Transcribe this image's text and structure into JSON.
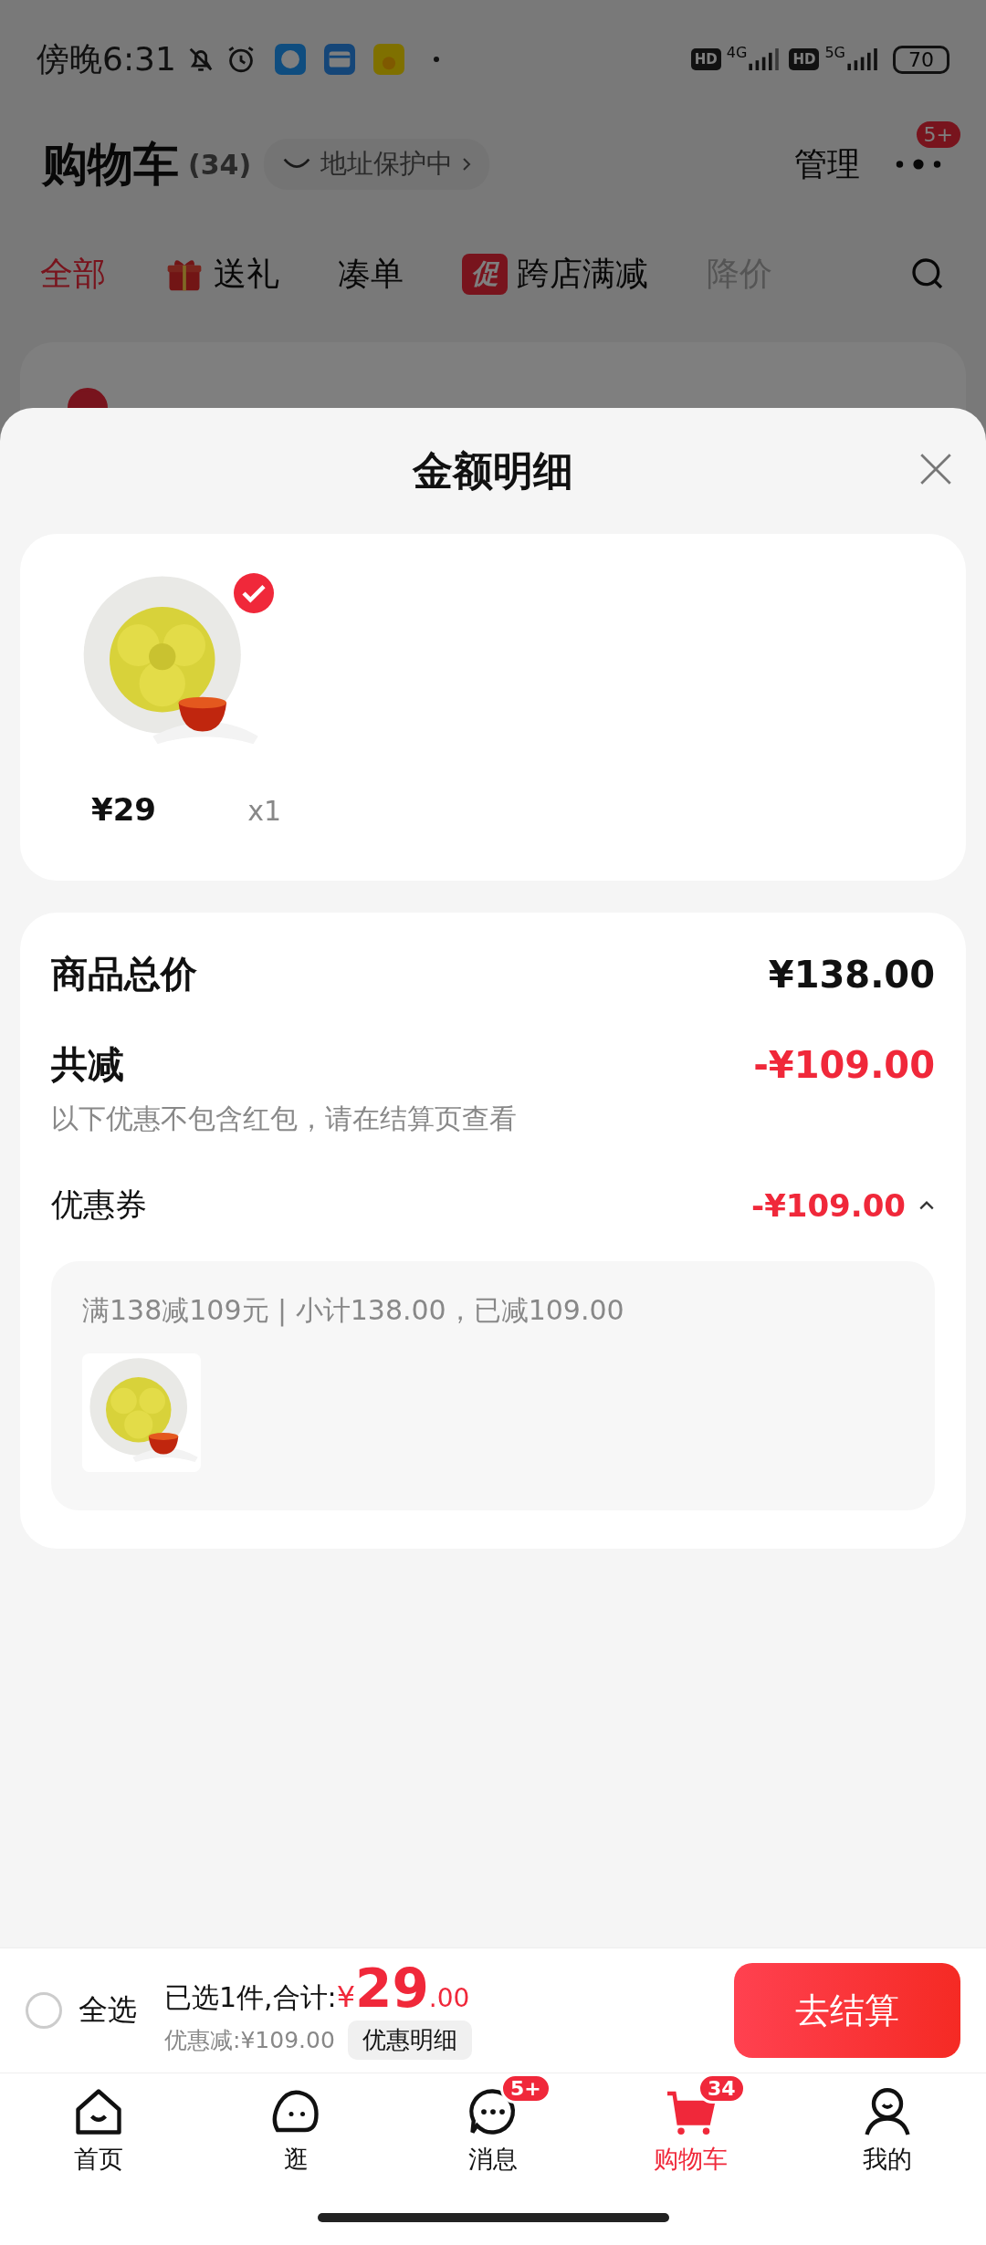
{
  "status_bar": {
    "time": "傍晚6:31",
    "sim1": {
      "hd": "HD",
      "net": "4G"
    },
    "sim2": {
      "hd": "HD",
      "net": "5G"
    },
    "battery": "70"
  },
  "header": {
    "title": "购物车",
    "count": "(34)",
    "address_badge": "地址保护中",
    "manage": "管理",
    "more_badge": "5+"
  },
  "tabs": [
    {
      "label": "全部",
      "selected": true,
      "kind": "text",
      "faded": false
    },
    {
      "label": "送礼",
      "selected": false,
      "kind": "gift",
      "faded": false
    },
    {
      "label": "凑单",
      "selected": false,
      "kind": "text",
      "faded": false
    },
    {
      "label": "跨店满减",
      "selected": false,
      "kind": "promo",
      "promo_mark": "促",
      "faded": false
    },
    {
      "label": "降价",
      "selected": false,
      "kind": "text",
      "faded": true
    }
  ],
  "store": {
    "checked": true
  },
  "sheet": {
    "title": "金额明细",
    "items": [
      {
        "price": "¥29",
        "qty": "x1",
        "checked": true
      }
    ],
    "summary": {
      "total_label": "商品总价",
      "total_value": "¥138.00",
      "discount_label": "共减",
      "discount_value": "-¥109.00",
      "note": "以下优惠不包含红包，请在结算页查看",
      "coupon": {
        "label": "优惠券",
        "value": "-¥109.00",
        "expanded": true,
        "rule": "满138减109元 | 小计138.00，已减109.00"
      }
    }
  },
  "footer": {
    "select_all": {
      "label": "全选",
      "checked": false
    },
    "selected_text": "已选1件,合计:",
    "currency": "¥",
    "amount": "29",
    "decimals": ".00",
    "discount": "优惠减:¥109.00",
    "detail_button": "优惠明细",
    "checkout": "去结算"
  },
  "nav": [
    {
      "label": "首页",
      "selected": false,
      "kind": "home"
    },
    {
      "label": "逛",
      "selected": false,
      "kind": "browse"
    },
    {
      "label": "消息",
      "selected": false,
      "kind": "message",
      "badge": "5+"
    },
    {
      "label": "购物车",
      "selected": true,
      "kind": "cart",
      "badge": "34"
    },
    {
      "label": "我的",
      "selected": false,
      "kind": "me"
    }
  ]
}
